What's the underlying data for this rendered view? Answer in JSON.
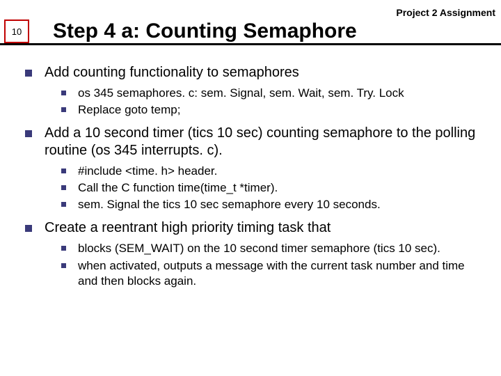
{
  "header": {
    "project": "Project 2 Assignment"
  },
  "page": {
    "number": "10",
    "title": "Step 4 a: Counting Semaphore"
  },
  "bullets": [
    {
      "text": "Add counting functionality to semaphores",
      "sub": [
        "os 345 semaphores. c: sem. Signal, sem. Wait, sem. Try. Lock",
        "Replace goto temp;"
      ]
    },
    {
      "text": "Add a 10 second timer (tics 10 sec) counting semaphore to the polling routine (os 345 interrupts. c).",
      "sub": [
        "#include <time. h> header.",
        "Call the C function time(time_t *timer).",
        "sem. Signal the tics 10 sec semaphore every 10 seconds."
      ]
    },
    {
      "text": "Create a reentrant high priority timing task that",
      "sub": [
        "blocks (SEM_WAIT) on the 10 second timer semaphore (tics 10 sec).",
        "when activated, outputs a message with the current task number and time and then blocks again."
      ]
    }
  ]
}
